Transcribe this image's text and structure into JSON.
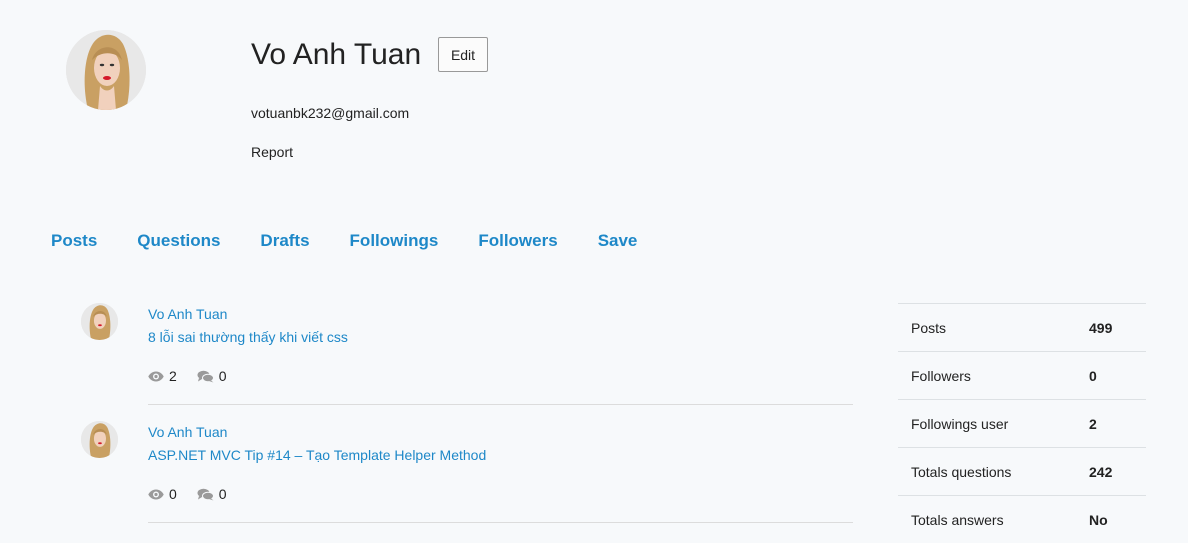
{
  "profile": {
    "name": "Vo Anh Tuan",
    "edit_label": "Edit",
    "email": "votuanbk232@gmail.com",
    "report_label": "Report"
  },
  "tabs": [
    "Posts",
    "Questions",
    "Drafts",
    "Followings",
    "Followers",
    "Save"
  ],
  "posts": [
    {
      "author": "Vo Anh Tuan",
      "title": "8 lỗi sai thường thấy khi viết css",
      "views": "2",
      "comments": "0"
    },
    {
      "author": "Vo Anh Tuan",
      "title": "ASP.NET MVC Tip #14 – Tạo Template Helper Method",
      "views": "0",
      "comments": "0"
    }
  ],
  "stats": [
    {
      "label": "Posts",
      "value": "499"
    },
    {
      "label": "Followers",
      "value": "0"
    },
    {
      "label": "Followings user",
      "value": "2"
    },
    {
      "label": "Totals questions",
      "value": "242"
    },
    {
      "label": "Totals answers",
      "value": "No"
    }
  ],
  "icons": {
    "views": "eye-icon",
    "comments": "comments-icon"
  },
  "colors": {
    "link": "#1e88c8",
    "background": "#f7f9fb",
    "icon": "#9a9a9a"
  }
}
